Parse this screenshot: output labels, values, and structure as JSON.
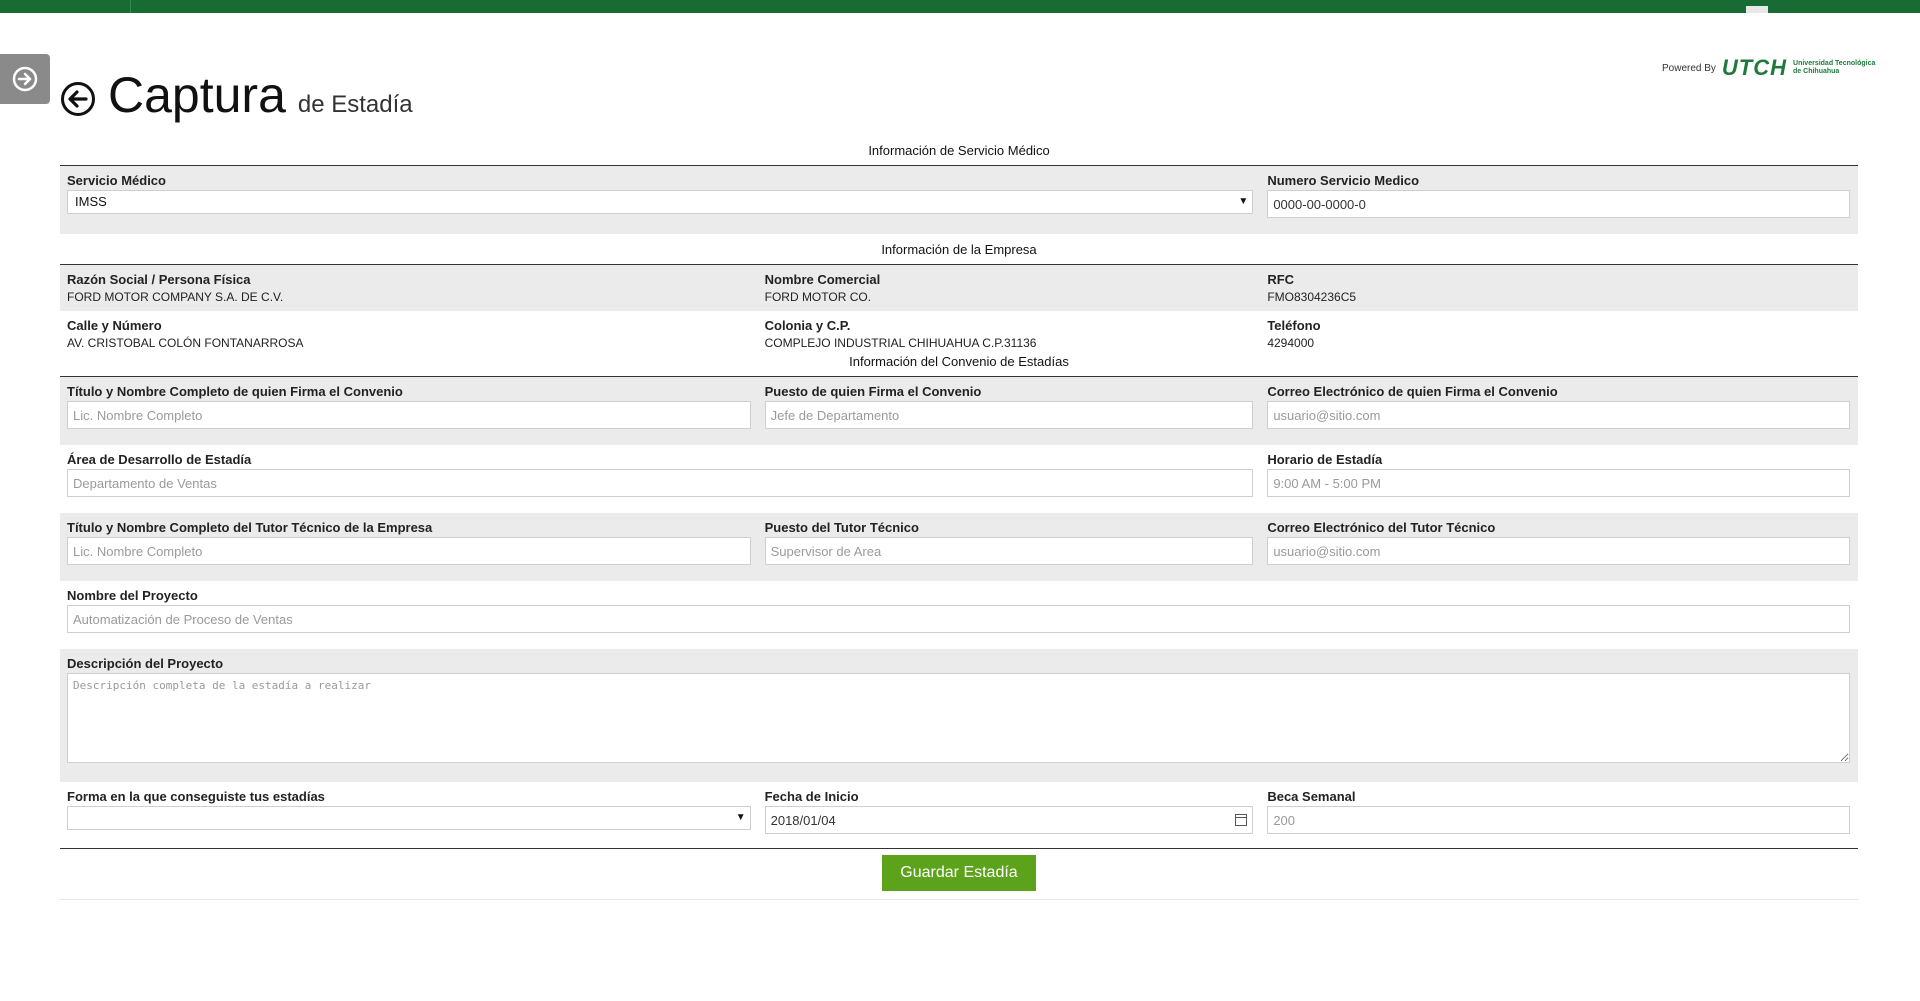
{
  "brand": {
    "powered_by": "Powered By",
    "logo": "UTCH",
    "university_line1": "Universidad Tecnológica",
    "university_line2": "de Chihuahua"
  },
  "header": {
    "title": "Captura",
    "subtitle": "de Estadía"
  },
  "sections": {
    "medical": "Información de Servicio Médico",
    "company": "Información de la Empresa",
    "agreement": "Información del Convenio de Estadías"
  },
  "medical": {
    "service_label": "Servicio Médico",
    "service_value": "IMSS",
    "number_label": "Numero Servicio Medico",
    "number_value": "0000-00-0000-0"
  },
  "company": {
    "razon_label": "Razón Social / Persona Física",
    "razon_value": "FORD MOTOR COMPANY S.A. DE C.V.",
    "comercial_label": "Nombre Comercial",
    "comercial_value": "FORD MOTOR CO.",
    "rfc_label": "RFC",
    "rfc_value": "FMO8304236C5",
    "calle_label": "Calle y Número",
    "calle_value": "AV. CRISTOBAL COLÓN FONTANARROSA",
    "colonia_label": "Colonia y C.P.",
    "colonia_value": "COMPLEJO INDUSTRIAL CHIHUAHUA C.P.31136",
    "telefono_label": "Teléfono",
    "telefono_value": "4294000"
  },
  "agreement": {
    "firma_nombre_label": "Título y Nombre Completo de quien Firma el Convenio",
    "firma_nombre_placeholder": "Lic. Nombre Completo",
    "firma_puesto_label": "Puesto de quien Firma el Convenio",
    "firma_puesto_placeholder": "Jefe de Departamento",
    "firma_correo_label": "Correo Electrónico de quien Firma el Convenio",
    "firma_correo_placeholder": "usuario@sitio.com",
    "area_label": "Área de Desarrollo de Estadía",
    "area_placeholder": "Departamento de Ventas",
    "horario_label": "Horario de Estadía",
    "horario_placeholder": "9:00 AM - 5:00 PM",
    "tutor_nombre_label": "Título y Nombre Completo del Tutor Técnico de la Empresa",
    "tutor_nombre_placeholder": "Lic. Nombre Completo",
    "tutor_puesto_label": "Puesto del Tutor Técnico",
    "tutor_puesto_placeholder": "Supervisor de Area",
    "tutor_correo_label": "Correo Electrónico del Tutor Técnico",
    "tutor_correo_placeholder": "usuario@sitio.com",
    "proyecto_label": "Nombre del Proyecto",
    "proyecto_placeholder": "Automatización de Proceso de Ventas",
    "descripcion_label": "Descripción del Proyecto",
    "descripcion_placeholder": "Descripción completa de la estadía a realizar",
    "forma_label": "Forma en la que conseguiste tus estadías",
    "forma_value": "",
    "fecha_label": "Fecha de Inicio",
    "fecha_value": "2018/01/04",
    "beca_label": "Beca Semanal",
    "beca_placeholder": "200"
  },
  "actions": {
    "save_label": "Guardar Estadía"
  },
  "colors": {
    "topbar": "#196b34",
    "save_button": "#5ca31b",
    "row_gray": "#ebebeb"
  }
}
